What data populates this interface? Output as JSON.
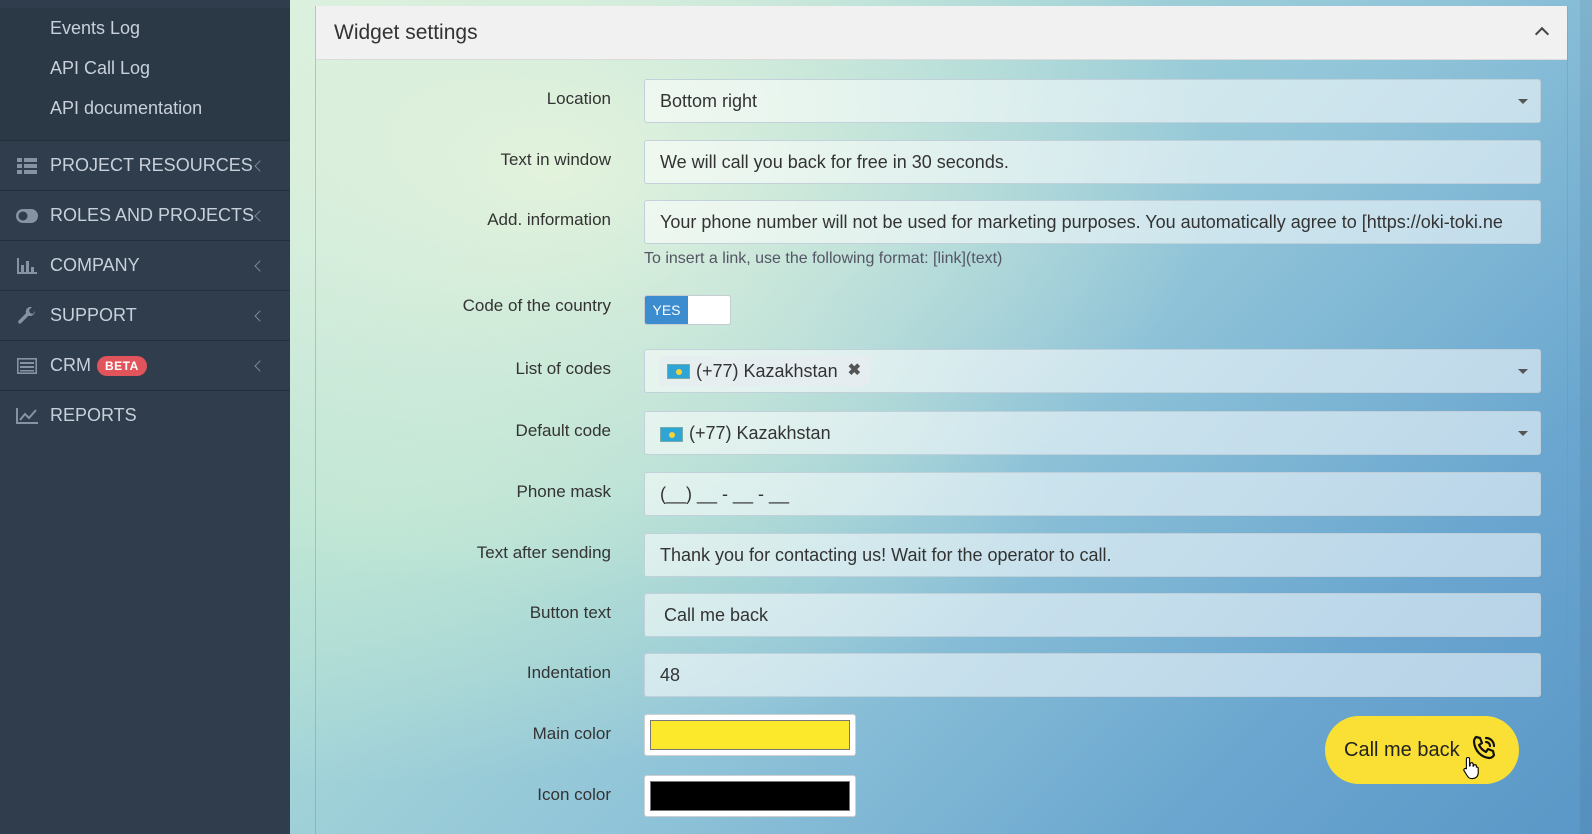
{
  "sidebar": {
    "subitems": [
      {
        "label": "Events Log"
      },
      {
        "label": "API Call Log"
      },
      {
        "label": "API documentation"
      }
    ],
    "menu": [
      {
        "label": "PROJECT RESOURCES",
        "icon": "grid-icon"
      },
      {
        "label": "ROLES AND PROJECTS",
        "icon": "toggle-icon"
      },
      {
        "label": "COMPANY",
        "icon": "bar-chart-icon"
      },
      {
        "label": "SUPPORT",
        "icon": "wrench-icon"
      },
      {
        "label": "CRM",
        "icon": "list-icon",
        "badge": "BETA"
      },
      {
        "label": "REPORTS",
        "icon": "line-chart-icon"
      }
    ]
  },
  "panel": {
    "title": "Widget settings"
  },
  "form": {
    "location": {
      "label": "Location",
      "value": "Bottom right"
    },
    "text_in_window": {
      "label": "Text in window",
      "value": "We will call you back for free in 30 seconds."
    },
    "add_info": {
      "label": "Add. information",
      "value": "Your phone number will not be used for marketing purposes. You automatically agree to [https://oki-toki.ne",
      "help": "To insert a link, use the following format: [link](text)"
    },
    "country_code": {
      "label": "Code of the country",
      "toggle_label": "YES"
    },
    "list_of_codes": {
      "label": "List of codes",
      "tag": "(+77) Kazakhstan"
    },
    "default_code": {
      "label": "Default code",
      "value": "(+77) Kazakhstan"
    },
    "phone_mask": {
      "label": "Phone mask",
      "value": "(__) __ - __ - __"
    },
    "text_after_sending": {
      "label": "Text after sending",
      "value": "Thank you for contacting us! Wait for the operator to call."
    },
    "button_text": {
      "label": "Button text",
      "value": "Call me back"
    },
    "indentation": {
      "label": "Indentation",
      "value": "48"
    },
    "main_color": {
      "label": "Main color",
      "color": "#fde92b"
    },
    "icon_color": {
      "label": "Icon color",
      "color": "#000000"
    }
  },
  "widget_preview": {
    "label": "Call me back",
    "color": "#fae034",
    "icon": "phone-icon"
  }
}
